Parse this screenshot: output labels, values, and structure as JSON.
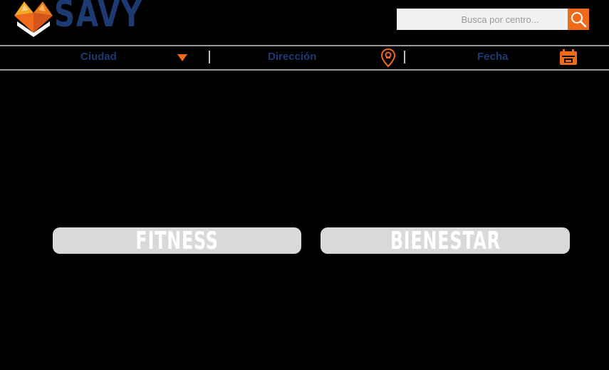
{
  "header": {
    "brand": "SAVY",
    "search": {
      "placeholder": "Busca por centro..."
    }
  },
  "filters": [
    {
      "label": "Ciudad",
      "icon": "chevron-down-icon"
    },
    {
      "label": "Dirección",
      "icon": "location-pin-icon"
    },
    {
      "label": "Fecha",
      "icon": "calendar-icon"
    }
  ],
  "categories": [
    {
      "label": "FITNESS"
    },
    {
      "label": "BIENESTAR"
    }
  ],
  "colors": {
    "brand_blue": "#1d3a73",
    "accent_orange": "#ef6a1a",
    "category_bg": "#d9d9d9",
    "divider": "#9a9a9a"
  }
}
